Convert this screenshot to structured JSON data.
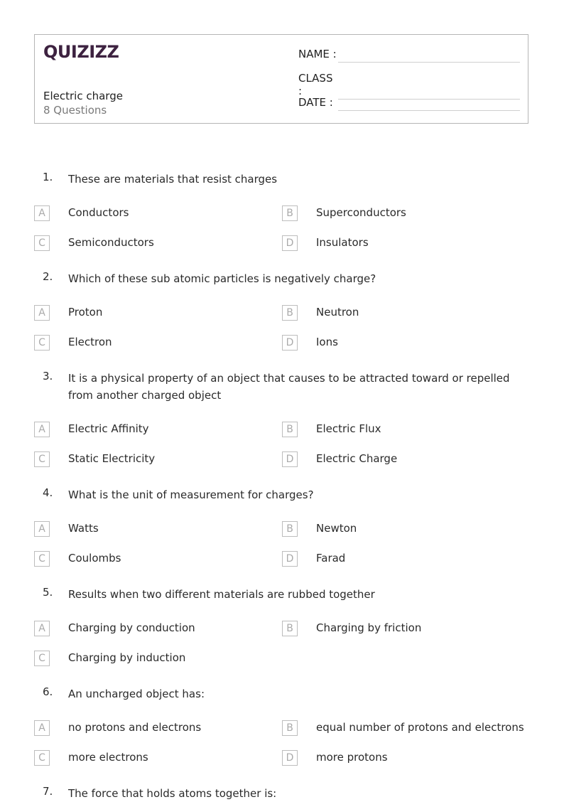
{
  "header": {
    "logo": "QUIZIZZ",
    "title": "Electric charge",
    "subtitle": "8 Questions",
    "fields": [
      "NAME :",
      "CLASS :",
      "DATE  :"
    ]
  },
  "questions": [
    {
      "num": "1.",
      "text": "These are materials that resist charges",
      "options": [
        {
          "letter": "A",
          "text": "Conductors"
        },
        {
          "letter": "B",
          "text": "Superconductors"
        },
        {
          "letter": "C",
          "text": "Semiconductors"
        },
        {
          "letter": "D",
          "text": "Insulators"
        }
      ]
    },
    {
      "num": "2.",
      "text": "Which of these sub atomic particles is negatively charge?",
      "options": [
        {
          "letter": "A",
          "text": "Proton"
        },
        {
          "letter": "B",
          "text": "Neutron"
        },
        {
          "letter": "C",
          "text": "Electron"
        },
        {
          "letter": "D",
          "text": "Ions"
        }
      ]
    },
    {
      "num": "3.",
      "text": "It is a physical property of an object that causes to be attracted toward or repelled from another charged object",
      "options": [
        {
          "letter": "A",
          "text": "Electric Affinity"
        },
        {
          "letter": "B",
          "text": "Electric Flux"
        },
        {
          "letter": "C",
          "text": "Static Electricity"
        },
        {
          "letter": "D",
          "text": "Electric Charge"
        }
      ]
    },
    {
      "num": "4.",
      "text": "What is the unit of measurement for charges?",
      "options": [
        {
          "letter": "A",
          "text": "Watts"
        },
        {
          "letter": "B",
          "text": "Newton"
        },
        {
          "letter": "C",
          "text": "Coulombs"
        },
        {
          "letter": "D",
          "text": "Farad"
        }
      ]
    },
    {
      "num": "5.",
      "text": "Results when two different materials are rubbed together",
      "options": [
        {
          "letter": "A",
          "text": "Charging by conduction"
        },
        {
          "letter": "B",
          "text": "Charging by friction"
        },
        {
          "letter": "C",
          "text": "Charging by induction"
        }
      ]
    },
    {
      "num": "6.",
      "text": "An uncharged object has:",
      "options": [
        {
          "letter": "A",
          "text": "no protons and electrons"
        },
        {
          "letter": "B",
          "text": "equal number of protons and electrons"
        },
        {
          "letter": "C",
          "text": "more electrons"
        },
        {
          "letter": "D",
          "text": "more protons"
        }
      ]
    },
    {
      "num": "7.",
      "text": "The force that holds atoms together is:",
      "options": []
    }
  ]
}
